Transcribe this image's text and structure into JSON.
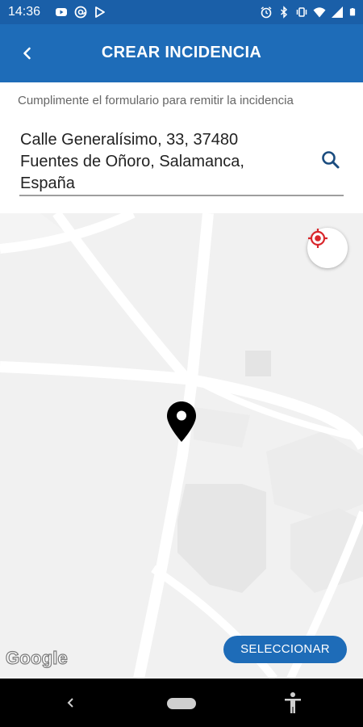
{
  "status_bar": {
    "time": "14:36",
    "left_icons": [
      "youtube-icon",
      "at-sign-icon",
      "play-store-icon"
    ],
    "right_icons": [
      "alarm-icon",
      "bluetooth-icon",
      "vibrate-icon",
      "wifi-icon",
      "signal-icon",
      "battery-icon"
    ]
  },
  "app_bar": {
    "back_icon": "chevron-left-icon",
    "title": "CREAR INCIDENCIA",
    "color": "#1e6cb8"
  },
  "form": {
    "subtitle": "Cumplimente el formulario para remitir la incidencia",
    "address_line1": "Calle Generalísimo, 33, 37480",
    "address_line2": "Fuentes de Oñoro, Salamanca,",
    "address_line3": "España",
    "search_icon": "search-icon"
  },
  "map": {
    "locate_icon": "my-location-icon",
    "pin_icon": "map-pin-icon",
    "attribution": "Google",
    "select_button": "SELECCIONAR"
  },
  "nav_bar": {
    "icons": [
      "back-icon",
      "home-pill-icon",
      "accessibility-icon"
    ]
  }
}
